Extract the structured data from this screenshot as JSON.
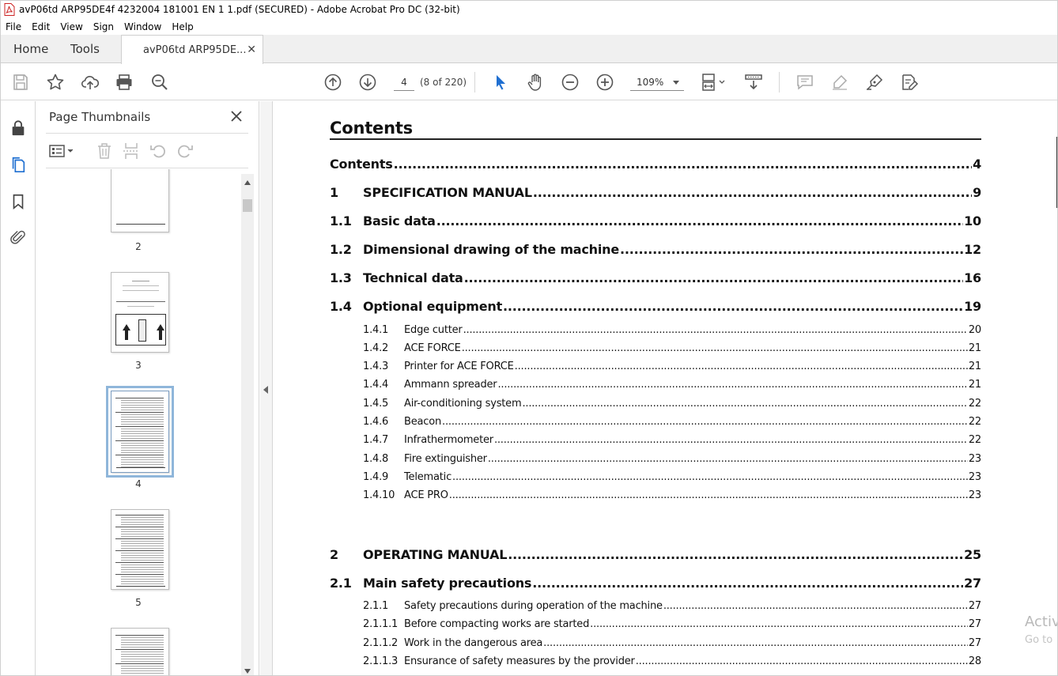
{
  "window": {
    "title": "avP06td ARP95DE4f 4232004 181001 EN 1 1.pdf (SECURED) - Adobe Acrobat Pro DC (32-bit)"
  },
  "menu": [
    "File",
    "Edit",
    "View",
    "Sign",
    "Window",
    "Help"
  ],
  "tabs": {
    "home": "Home",
    "tools": "Tools",
    "document": "avP06td ARP95DE..."
  },
  "toolbar": {
    "page_current": "4",
    "page_count": "(8 of 220)",
    "zoom": "109%"
  },
  "thumbnails": {
    "title": "Page Thumbnails",
    "pages": [
      {
        "label": "2",
        "selected": false
      },
      {
        "label": "3",
        "selected": false
      },
      {
        "label": "4",
        "selected": true
      },
      {
        "label": "5",
        "selected": false
      },
      {
        "label": "",
        "selected": false
      }
    ]
  },
  "document": {
    "heading": "Contents",
    "entries": [
      {
        "level": 1,
        "num": "",
        "title": "Contents",
        "page": "4"
      },
      {
        "level": 1,
        "num": "1",
        "title": "SPECIFICATION MANUAL",
        "page": "9"
      },
      {
        "level": 1,
        "num": "1.1",
        "title": "Basic data",
        "page": "10"
      },
      {
        "level": 1,
        "num": "1.2",
        "title": "Dimensional drawing of the machine",
        "page": "12"
      },
      {
        "level": 1,
        "num": "1.3",
        "title": "Technical data",
        "page": "16"
      },
      {
        "level": 1,
        "num": "1.4",
        "title": "Optional equipment",
        "page": "19"
      },
      {
        "level": 2,
        "num": "1.4.1",
        "title": "Edge cutter",
        "page": "20"
      },
      {
        "level": 2,
        "num": "1.4.2",
        "title": "ACE FORCE",
        "page": "21"
      },
      {
        "level": 2,
        "num": "1.4.3",
        "title": "Printer for ACE FORCE",
        "page": "21"
      },
      {
        "level": 2,
        "num": "1.4.4",
        "title": "Ammann spreader",
        "page": "21"
      },
      {
        "level": 2,
        "num": "1.4.5",
        "title": "Air-conditioning system",
        "page": "22"
      },
      {
        "level": 2,
        "num": "1.4.6",
        "title": "Beacon",
        "page": "22"
      },
      {
        "level": 2,
        "num": "1.4.7",
        "title": "Infrathermometer",
        "page": "22"
      },
      {
        "level": 2,
        "num": "1.4.8",
        "title": "Fire extinguisher",
        "page": "23"
      },
      {
        "level": 2,
        "num": "1.4.9",
        "title": "Telematic",
        "page": "23"
      },
      {
        "level": 2,
        "num": "1.4.10",
        "title": "ACE PRO",
        "page": "23"
      },
      {
        "level": 1,
        "num": "2",
        "title": "OPERATING MANUAL",
        "page": "25"
      },
      {
        "level": 1,
        "num": "2.1",
        "title": "Main safety precautions",
        "page": "27"
      },
      {
        "level": 2,
        "num": "2.1.1",
        "title": "Safety precautions during operation of the machine",
        "page": "27"
      },
      {
        "level": 2,
        "num": "2.1.1.1",
        "title": "Before compacting works are started",
        "page": "27"
      },
      {
        "level": 2,
        "num": "2.1.1.2",
        "title": "Work in the dangerous area",
        "page": "27"
      },
      {
        "level": 2,
        "num": "2.1.1.3",
        "title": "Ensurance of safety measures by the provider",
        "page": "28"
      }
    ]
  },
  "watermark": {
    "line1": "Activ",
    "line2": "Go to"
  }
}
